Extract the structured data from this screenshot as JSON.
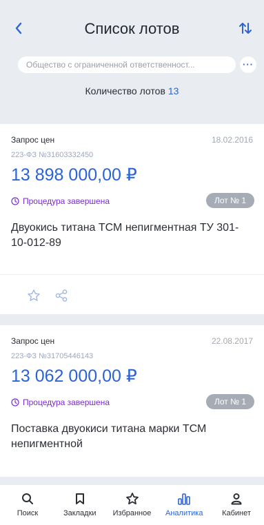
{
  "header": {
    "title": "Список лотов",
    "search_text": "Общество с ограниченной ответственност...",
    "more_label": "···",
    "lot_count_label": "Количество лотов",
    "lot_count_value": "13"
  },
  "lots": [
    {
      "type": "Запрос цен",
      "date": "18.02.2016",
      "law_number": "223-ФЗ №31603332450",
      "price": "13 898 000,00 ₽",
      "status": "Процедура завершена",
      "lot_badge": "Лот № 1",
      "description": "Двуокись титана ТСМ непигментная ТУ 301-10-012-89"
    },
    {
      "type": "Запрос цен",
      "date": "22.08.2017",
      "law_number": "223-ФЗ №31705446143",
      "price": "13 062 000,00 ₽",
      "status": "Процедура завершена",
      "lot_badge": "Лот № 1",
      "description": "Поставка двуокиси титана марки ТСМ непигментной"
    }
  ],
  "tabbar": [
    {
      "label": "Поиск",
      "icon": "search-icon"
    },
    {
      "label": "Закладки",
      "icon": "bookmark-icon"
    },
    {
      "label": "Избранное",
      "icon": "star-icon"
    },
    {
      "label": "Аналитика",
      "icon": "chart-icon",
      "active": true
    },
    {
      "label": "Кабинет",
      "icon": "user-icon"
    }
  ],
  "colors": {
    "accent": "#2b63d6",
    "status": "#7b2bd1",
    "background": "#e9ecf0"
  }
}
